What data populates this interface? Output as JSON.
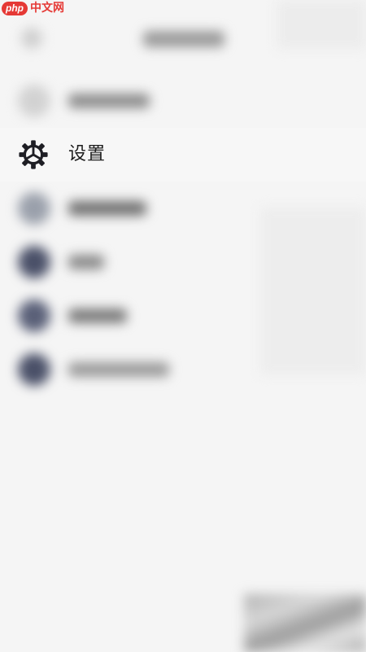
{
  "watermark": {
    "pill": "php",
    "text": "中文网"
  },
  "settings_item": {
    "label": "设置",
    "icon": "gear-icon"
  },
  "blurred_items": [
    {
      "icon_color": "#d2d2d2",
      "text_color": "#8c8c8c",
      "text_width": 100,
      "has_right": false
    },
    {
      "icon_color": "#9aa0ab",
      "text_color": "#707070",
      "text_width": 96,
      "has_right": false
    },
    {
      "icon_color": "#4a5068",
      "text_color": "#8a8a8a",
      "text_width": 44,
      "has_right": true
    },
    {
      "icon_color": "#5a6078",
      "text_color": "#7a7a7a",
      "text_width": 72,
      "has_right": true
    },
    {
      "icon_color": "#4a5068",
      "text_color": "#9a9a9a",
      "text_width": 124,
      "has_right": false
    }
  ]
}
